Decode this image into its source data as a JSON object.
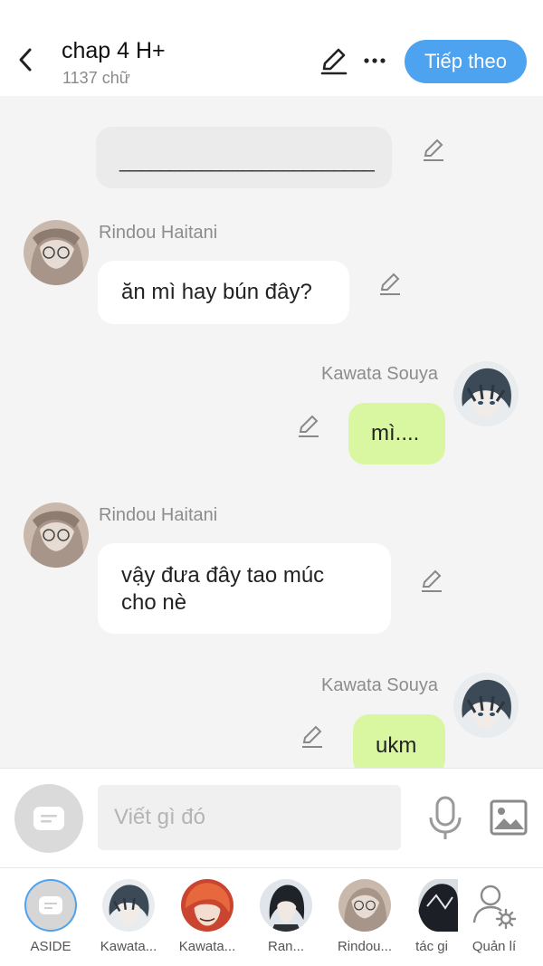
{
  "header": {
    "title": "chap 4 H+",
    "word_count": "1137 chữ",
    "next_label": "Tiếp theo",
    "accent": "#4da3ef"
  },
  "messages": [
    {
      "kind": "narration",
      "text": "_________________________"
    },
    {
      "kind": "left",
      "sender": "Rindou Haitani",
      "text": "ăn mì hay bún đây?"
    },
    {
      "kind": "right",
      "sender": "Kawata Souya",
      "text": "mì...."
    },
    {
      "kind": "left",
      "sender": "Rindou Haitani",
      "line1": "vậy đưa đây tao múc",
      "line2": "cho nè"
    },
    {
      "kind": "right",
      "sender": "Kawata Souya",
      "text": "ukm"
    }
  ],
  "composer": {
    "placeholder": "Viết gì đó"
  },
  "characters": [
    {
      "label": "ASIDE"
    },
    {
      "label": "Kawata..."
    },
    {
      "label": "Kawata..."
    },
    {
      "label": "Ran..."
    },
    {
      "label": "Rindou..."
    },
    {
      "label": "tác gi"
    },
    {
      "label": "Quản lí"
    }
  ],
  "colors": {
    "right_bubble": "#d9f7a0",
    "left_bubble": "#ffffff",
    "narration_bubble": "#ebebeb"
  }
}
